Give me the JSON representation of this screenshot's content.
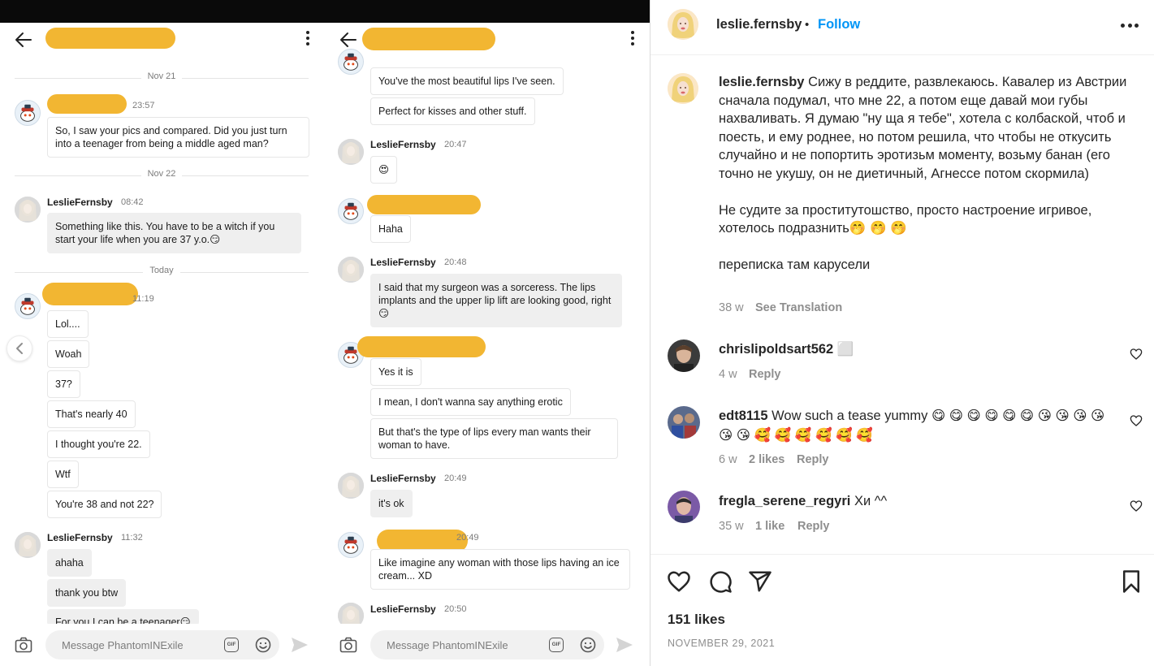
{
  "pane1": {
    "composer_placeholder": "Message PhantomINExile",
    "gif_label": "GIF",
    "dates": [
      "Nov 21",
      "Nov 22",
      "Today"
    ],
    "groups": [
      {
        "sender": "",
        "time": "23:57",
        "messages": [
          "So, I saw your pics and compared. Did you just turn into a teenager from being a middle aged man?"
        ]
      },
      {
        "sender": "LeslieFernsby",
        "time": "08:42",
        "messages": [
          "Something like this. You have to be a witch if you start your life when you are 37 y.o.😏"
        ]
      },
      {
        "sender": "",
        "time": "11:19",
        "messages": [
          "Lol....",
          "Woah",
          "37?",
          "That's nearly 40",
          "I thought you're 22.",
          "Wtf",
          "You're 38 and not 22?"
        ]
      },
      {
        "sender": "LeslieFernsby",
        "time": "11:32",
        "messages": [
          "ahaha",
          "thank you btw",
          "For you I can be a teenager😏"
        ]
      }
    ]
  },
  "pane2": {
    "composer_placeholder": "Message PhantomINExile",
    "gif_label": "GIF",
    "groups": [
      {
        "sender": "",
        "time": "",
        "messages": [
          "You've the most beautiful lips I've seen.",
          "Perfect for kisses and other stuff."
        ]
      },
      {
        "sender": "LeslieFernsby",
        "time": "20:47",
        "messages": [
          "😍"
        ]
      },
      {
        "sender": "",
        "time": "",
        "messages": [
          "Haha"
        ]
      },
      {
        "sender": "LeslieFernsby",
        "time": "20:48",
        "messages": [
          "I said that my surgeon was a sorceress. The lips implants and the upper lip lift are looking good, right😏"
        ]
      },
      {
        "sender": "",
        "time": "",
        "messages": [
          "Yes it is",
          "I mean, I don't wanna say anything erotic",
          "But that's the type of lips every man wants their woman to have."
        ]
      },
      {
        "sender": "LeslieFernsby",
        "time": "20:49",
        "messages": [
          "it's ok"
        ]
      },
      {
        "sender": "",
        "time": "20:49",
        "messages": [
          "Like imagine any woman with those lips having an ice cream... XD"
        ]
      },
      {
        "sender": "LeslieFernsby",
        "time": "20:50",
        "messages": []
      }
    ]
  },
  "ig": {
    "username": "leslie.fernsby",
    "dot": "•",
    "follow": "Follow",
    "caption_user": "leslie.fernsby",
    "caption_p1": "Сижу в реддите, развлекаюсь. Кавалер из Австрии сначала подумал, что мне 22, а потом еще давай мои губы нахваливать. Я думаю \"ну ща я тебе\", хотела с колбаской, чтоб и поесть, и ему роднее, но потом решила, что чтобы не откусить случайно и не попортить эротизьм моменту, возьму банан (его точно не укушу, он не диетичный, Агнессе потом скормила)",
    "caption_p2": "Не судите за проститутошство, просто настроение игривое, хотелось подразнить🤭 🤭 🤭",
    "caption_p3": "переписка там карусели",
    "caption_age": "38 w",
    "see_translation": "See Translation",
    "comments": [
      {
        "user": "chrislipoldsart562",
        "text": " ⬜",
        "age": "4 w",
        "likes": "",
        "reply": "Reply"
      },
      {
        "user": "edt8115",
        "text": " Wow such a tease yummy 😋 😋 😋 😋 😋 😋 😘 😘 😘 😘 😘 😘 🥰 🥰 🥰 🥰 🥰 🥰",
        "age": "6 w",
        "likes": "2 likes",
        "reply": "Reply"
      },
      {
        "user": "fregla_serene_regyri",
        "text": " Хи ^^",
        "age": "35 w",
        "likes": "1 like",
        "reply": "Reply"
      }
    ],
    "likes": "151 likes",
    "date": "NOVEMBER 29, 2021",
    "icons": [
      "heart-icon",
      "comment-icon",
      "share-icon",
      "bookmark-icon"
    ]
  }
}
